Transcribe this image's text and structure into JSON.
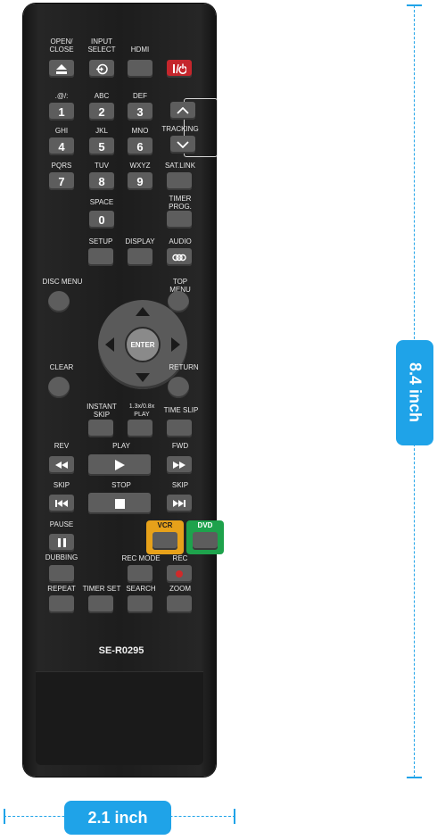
{
  "remote": {
    "model": "SE-R0295",
    "labels": {
      "open_close": "OPEN/\nCLOSE",
      "input_select": "INPUT\nSELECT",
      "hdmi": "HDMI",
      "sym": ".@/:",
      "abc": "ABC",
      "def": "DEF",
      "ghi": "GHI",
      "jkl": "JKL",
      "mno": "MNO",
      "pqrs": "PQRS",
      "tuv": "TUV",
      "wxyz": "WXYZ",
      "sat_link": "SAT.LINK",
      "tracking": "TRACKING",
      "space": "SPACE",
      "timer_prog": "TIMER\nPROG.",
      "setup": "SETUP",
      "display": "DISPLAY",
      "audio": "AUDIO",
      "disc_menu": "DISC MENU",
      "top_menu": "TOP MENU",
      "enter": "ENTER",
      "clear": "CLEAR",
      "return": "RETURN",
      "instant_skip": "INSTANT\nSKIP",
      "play_speed": "1.3x/0.8x\nPLAY",
      "time_slip": "TIME SLIP",
      "rev": "REV",
      "play": "PLAY",
      "fwd": "FWD",
      "skip_left": "SKIP",
      "stop": "STOP",
      "skip_right": "SKIP",
      "pause": "PAUSE",
      "vcr": "VCR",
      "dvd": "DVD",
      "dubbing": "DUBBING",
      "rec_mode": "REC MODE",
      "rec": "REC",
      "repeat": "REPEAT",
      "timer_set": "TIMER SET",
      "search": "SEARCH",
      "zoom": "ZOOM"
    },
    "digits": [
      "1",
      "2",
      "3",
      "4",
      "5",
      "6",
      "7",
      "8",
      "9",
      "0"
    ],
    "colors": {
      "power": "#c5262c",
      "vcr": "#e7a11a",
      "dvd": "#1ea24c",
      "accent": "#1fa3e8"
    }
  },
  "dimensions": {
    "height": "8.4 inch",
    "width": "2.1 inch"
  }
}
